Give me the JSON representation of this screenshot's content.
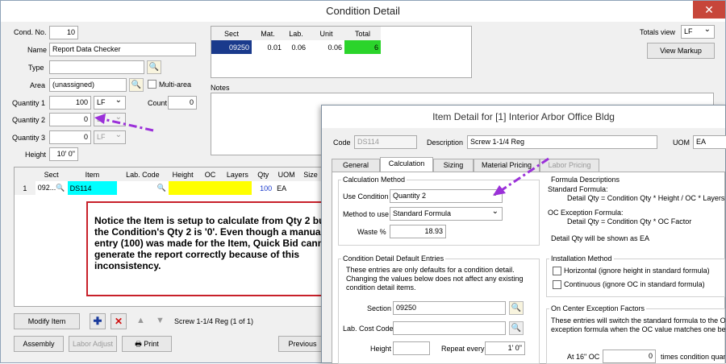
{
  "window": {
    "title": "Condition Detail",
    "close_glyph": "✕"
  },
  "cond": {
    "cond_no_label": "Cond. No.",
    "cond_no": "10",
    "name_label": "Name",
    "name": "Report Data Checker",
    "type_label": "Type",
    "type": "",
    "area_label": "Area",
    "area": "(unassigned)",
    "multiarea_label": "Multi-area",
    "qty1_label": "Quantity 1",
    "qty1": "100",
    "qty1_uom": "LF",
    "count_label": "Count",
    "count": "0",
    "qty2_label": "Quantity 2",
    "qty2": "0",
    "qty2_uom": "LF",
    "qty3_label": "Quantity 3",
    "qty3": "0",
    "qty3_uom": "LF",
    "height_label": "Height",
    "height": "10' 0\""
  },
  "summary": {
    "headers": [
      "Sect",
      "Mat.",
      "Lab.",
      "Unit",
      "Total"
    ],
    "row": [
      "09250",
      "0.01",
      "0.06",
      "0.06",
      "6"
    ],
    "totals_view_label": "Totals view",
    "totals_view": "LF",
    "view_markup": "View Markup",
    "notes_label": "Notes"
  },
  "items_grid": {
    "headers": [
      "Sect",
      "Item",
      "Lab. Code",
      "Height",
      "OC",
      "Layers",
      "Qty",
      "UOM",
      "Size"
    ],
    "row": {
      "num": "1",
      "sect": "092...",
      "item": "DS114",
      "lab_code": "",
      "height": "",
      "oc": "",
      "layers": "",
      "qty": "100",
      "uom": "EA"
    }
  },
  "bottom": {
    "modify_item": "Modify Item",
    "item_status": "Screw 1-1/4  Reg (1 of 1)",
    "assembly": "Assembly",
    "labor_adjust": "Labor Adjust",
    "print": "Print",
    "previous": "Previous"
  },
  "callout": {
    "text": "Notice the Item is setup to calculate from Qty 2 but the Condition's Qty 2 is '0'.  Even though a manual entry (100) was made for the Item, Quick Bid cannot generate the report correctly because of this inconsistency."
  },
  "item_detail": {
    "title": "Item Detail for [1] Interior Arbor Office Bldg",
    "code_label": "Code",
    "code": "DS114",
    "desc_label": "Description",
    "desc": "Screw 1-1/4  Reg",
    "uom_label": "UOM",
    "uom": "EA",
    "tabs": [
      "General",
      "Calculation",
      "Sizing",
      "Material Pricing",
      "Labor Pricing"
    ],
    "calc_method_label": "Calculation Method",
    "use_cond_label": "Use Condition",
    "use_cond": "Quantity 2",
    "method_label": "Method to use",
    "method": "Standard Formula",
    "waste_label": "Waste %",
    "waste": "18.93",
    "defaults_label": "Condition Detail Default Entries",
    "defaults_note": "These entries are only defaults for a condition detail. Changing the values below does not affect any existing condition detail items.",
    "section_label": "Section",
    "section": "09250",
    "lab_cost_label": "Lab. Cost Code",
    "lab_cost": "",
    "height_label": "Height",
    "height": "",
    "repeat_label": "Repeat every",
    "repeat": "1' 0\"",
    "formula_desc_label": "Formula Descriptions",
    "std_formula_label": "Standard Formula:",
    "std_formula": "Detail Qty = Condition Qty * Height / OC * Layers",
    "oc_formula_label": "OC Exception Formula:",
    "oc_formula": "Detail Qty = Condition Qty * OC Factor",
    "shown_as": "Detail Qty will be shown as EA",
    "install_label": "Installation Method",
    "horizontal": "Horizontal (ignore height in standard formula)",
    "continuous": "Continuous (ignore OC in standard formula)",
    "oc_exc_label": "On Center Exception Factors",
    "oc_exc_note": "These entries will switch the standard formula to the OC exception formula when the OC value matches one belo",
    "at16_label": "At 16\" OC",
    "at16": "0",
    "at16_suffix": "times condition quan"
  },
  "colors": {
    "accent_arrow": "#9b30d9",
    "callout_border": "#c8202a",
    "highlight_green": "#2bd42b",
    "highlight_yellow": "#ffff00",
    "highlight_cyan": "#00ffff",
    "selected_blue": "#1a3a8c"
  }
}
